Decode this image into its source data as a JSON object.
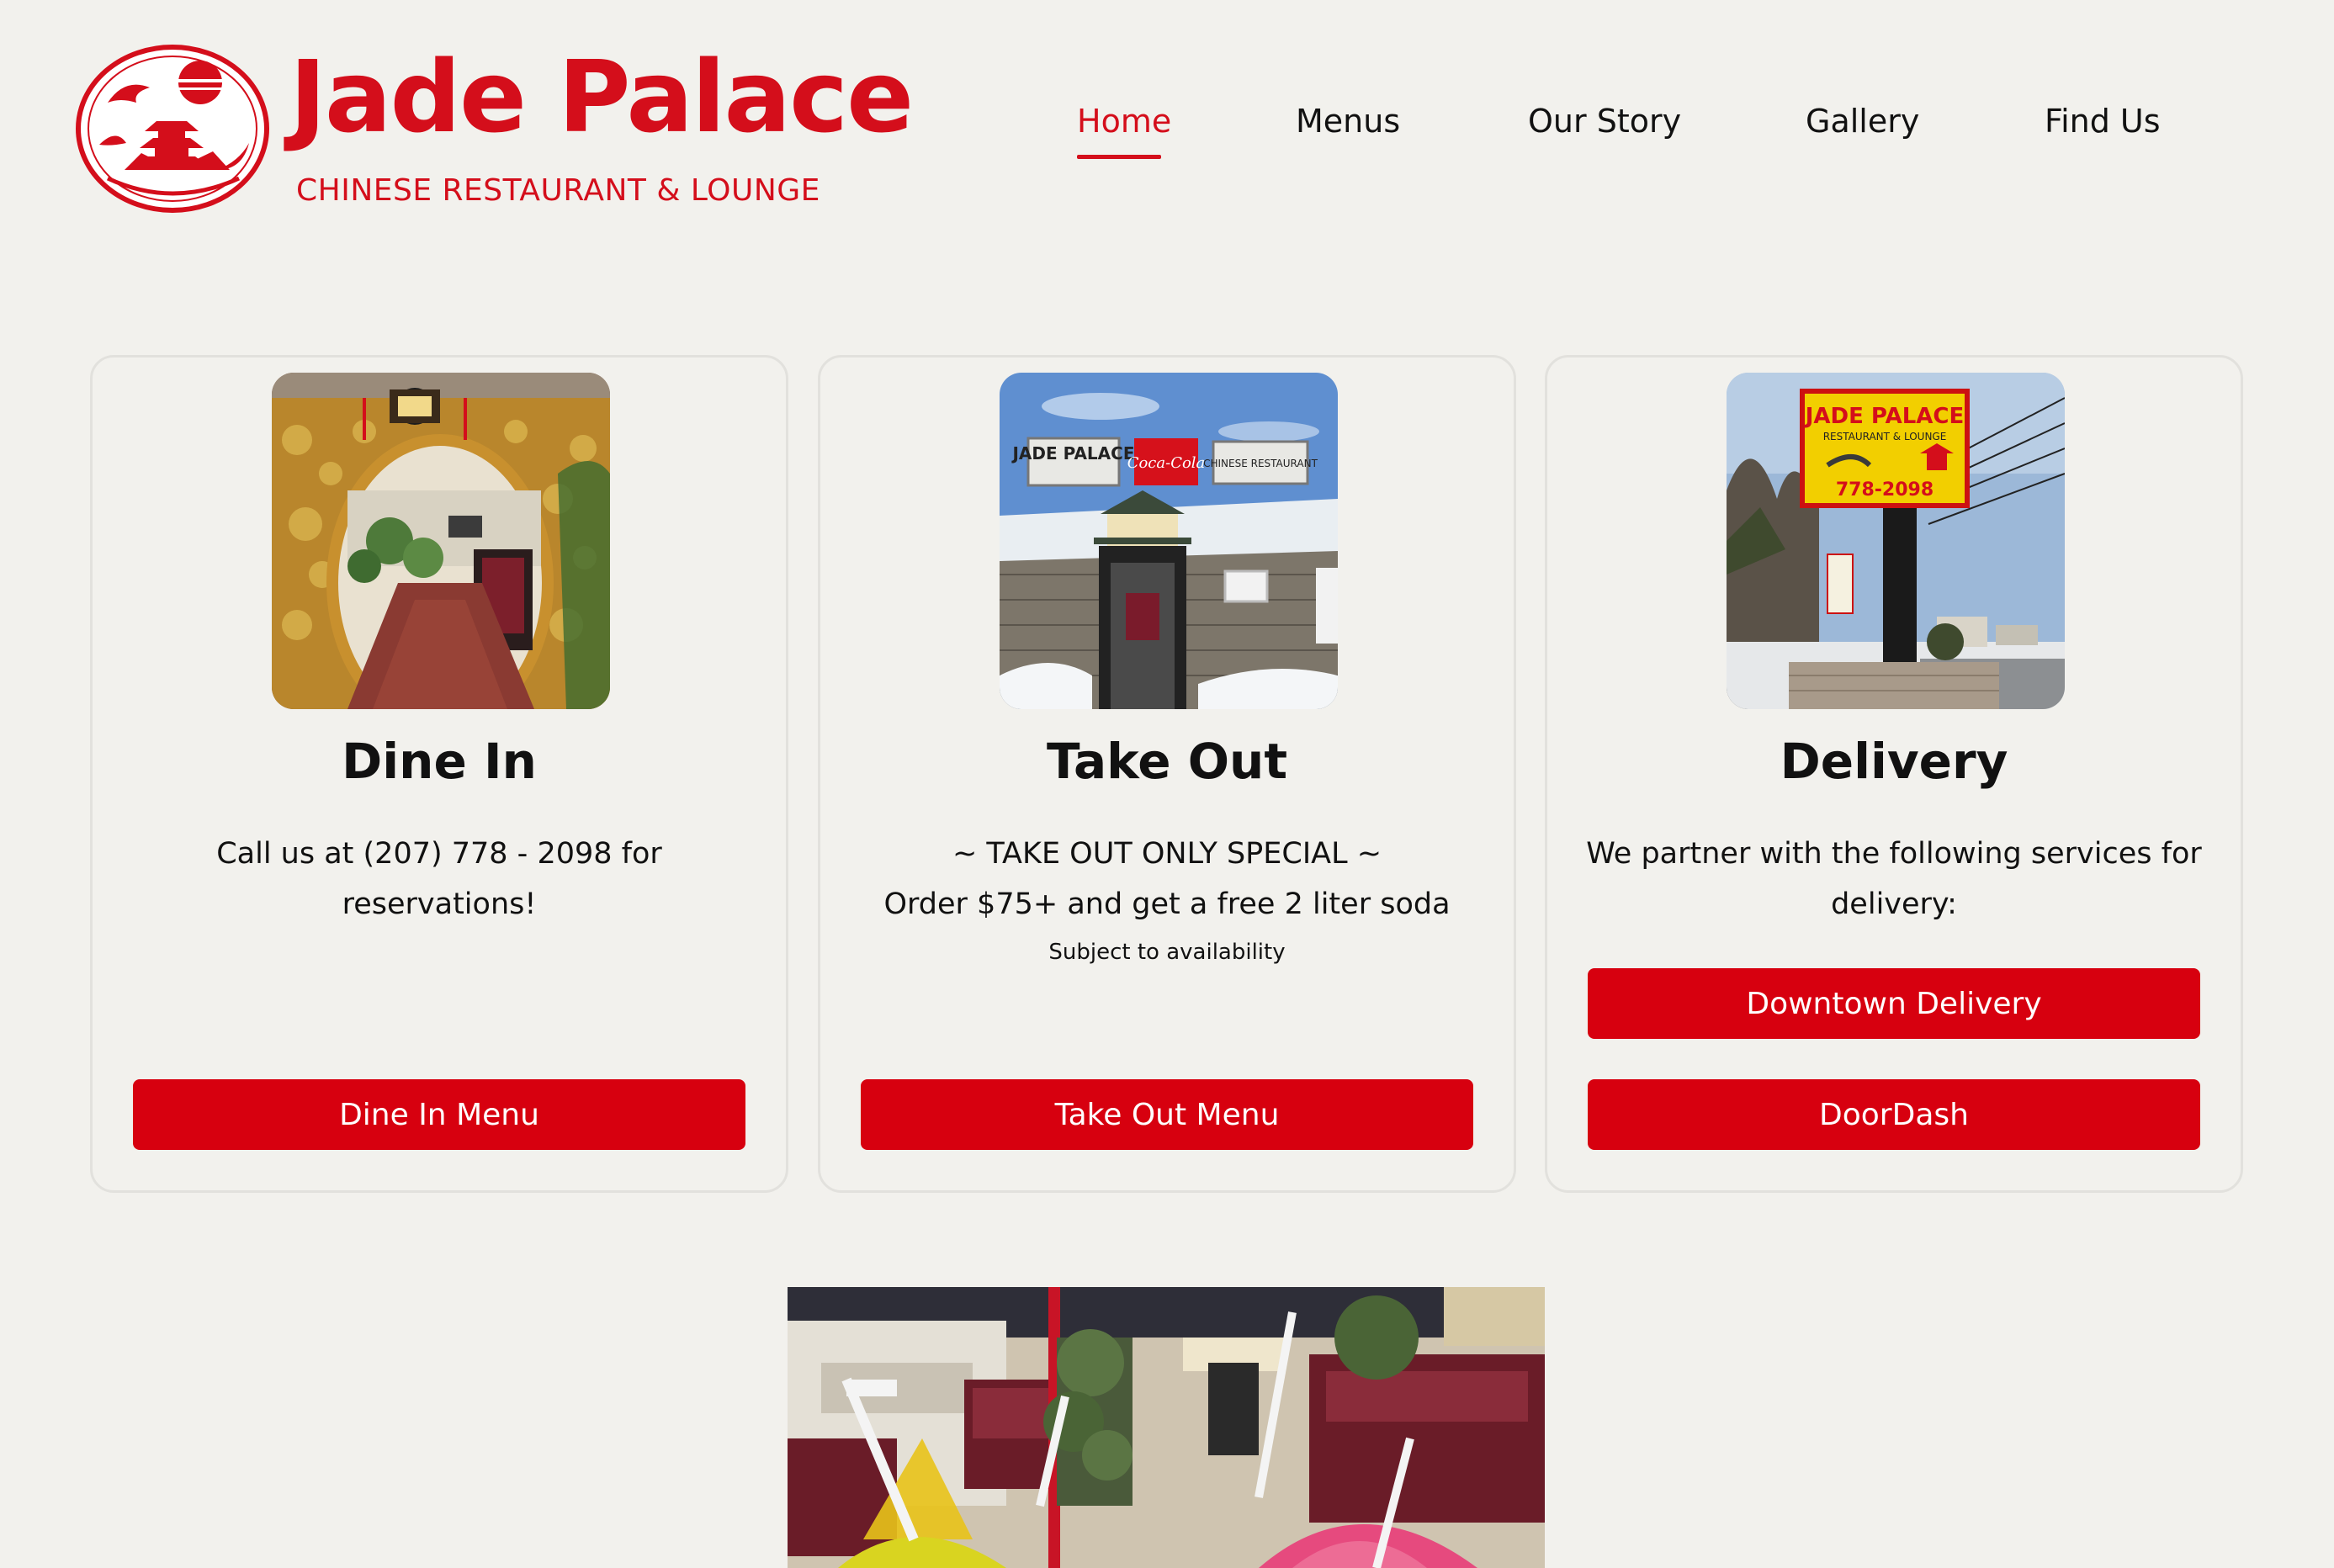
{
  "brand": {
    "title": "Jade Palace",
    "subtitle": "CHINESE RESTAURANT & LOUNGE",
    "logo_icon": "pagoda-seal-icon",
    "accent_color": "#d40e1b"
  },
  "nav": {
    "items": [
      {
        "label": "Home",
        "active": true
      },
      {
        "label": "Menus",
        "active": false
      },
      {
        "label": "Our Story",
        "active": false
      },
      {
        "label": "Gallery",
        "active": false
      },
      {
        "label": "Find Us",
        "active": false
      }
    ]
  },
  "cards": [
    {
      "title": "Dine In",
      "text": "Call us at (207) 778 - 2098 for reservations!",
      "buttons": [
        {
          "label": "Dine In Menu"
        }
      ]
    },
    {
      "title": "Take Out",
      "text_line1": "~ TAKE OUT ONLY SPECIAL ~",
      "text_line2": "Order $75+ and get a free 2 liter soda",
      "small": "Subject to availability",
      "photo_sign": {
        "left": "JADE PALACE",
        "center": "Coca-Cola",
        "right": "CHINESE RESTAURANT"
      },
      "buttons": [
        {
          "label": "Take Out Menu"
        }
      ]
    },
    {
      "title": "Delivery",
      "text": "We partner with the following services for delivery:",
      "photo_sign": {
        "title": "JADE PALACE",
        "subtitle": "RESTAURANT & LOUNGE",
        "phone": "778-2098"
      },
      "buttons": [
        {
          "label": "Downtown Delivery"
        },
        {
          "label": "DoorDash"
        }
      ]
    }
  ],
  "button_color": "#d7000f"
}
